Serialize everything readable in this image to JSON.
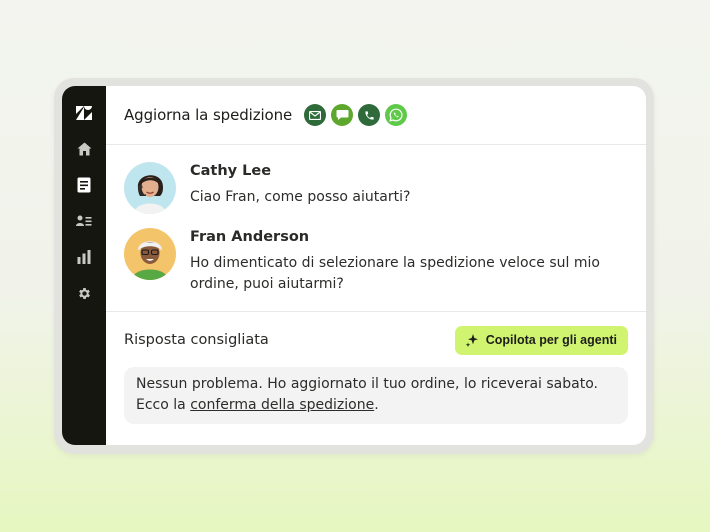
{
  "ticket": {
    "title": "Aggiorna la spedizione"
  },
  "channels": [
    {
      "name": "email-icon",
      "color": "#2f6b3a"
    },
    {
      "name": "chat-icon",
      "color": "#5da72c"
    },
    {
      "name": "phone-icon",
      "color": "#2f6b3a"
    },
    {
      "name": "whatsapp-icon",
      "color": "#5fc94a"
    }
  ],
  "sidebar": {
    "items": [
      {
        "icon": "zendesk-logo-icon"
      },
      {
        "icon": "home-icon"
      },
      {
        "icon": "tickets-icon"
      },
      {
        "icon": "contacts-icon"
      },
      {
        "icon": "reporting-icon"
      },
      {
        "icon": "settings-icon"
      }
    ]
  },
  "conversation": {
    "messages": [
      {
        "sender": "Cathy Lee",
        "text": "Ciao Fran, come posso aiutarti?"
      },
      {
        "sender": "Fran Anderson",
        "text": "Ho dimenticato di selezionare la spedizione veloce sul mio ordine, puoi aiutarmi?"
      }
    ]
  },
  "suggestion": {
    "title": "Risposta consigliata",
    "copilot_label": "Copilota per gli agenti",
    "reply_text": "Nessun problema. Ho aggiornato il tuo ordine, lo riceverai sabato. Ecco la ",
    "reply_link": "conferma della spedizione",
    "reply_end": "."
  },
  "colors": {
    "sidebar": "#161610",
    "accent": "#d1f470"
  }
}
